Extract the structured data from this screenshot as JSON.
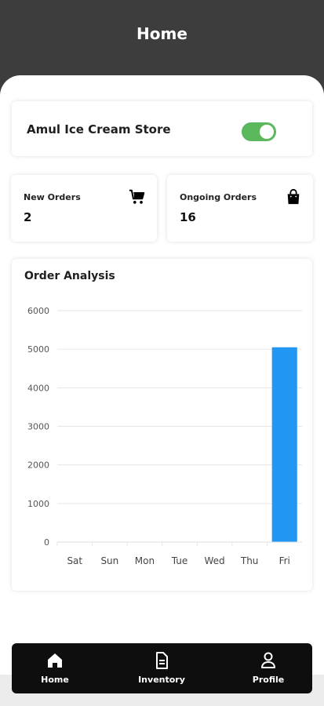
{
  "header": {
    "title": "Home"
  },
  "store": {
    "name": "Amul Ice Cream Store",
    "open_toggle_on": true,
    "toggle_color": "#5cb85c"
  },
  "stats": [
    {
      "label": "New Orders",
      "value": "2",
      "icon": "cart-icon"
    },
    {
      "label": "Ongoing Orders",
      "value": "16",
      "icon": "shopping-bag-icon"
    }
  ],
  "chart_title": "Order Analysis",
  "chart_data": {
    "type": "bar",
    "categories": [
      "Sat",
      "Sun",
      "Mon",
      "Tue",
      "Wed",
      "Thu",
      "Fri"
    ],
    "values": [
      0,
      0,
      0,
      0,
      0,
      0,
      5050
    ],
    "ylim": [
      0,
      6000
    ],
    "yticks": [
      0,
      1000,
      2000,
      3000,
      4000,
      5000,
      6000
    ],
    "bar_color": "#2196f3",
    "grid": true
  },
  "nav": [
    {
      "label": "Home",
      "icon": "home-icon"
    },
    {
      "label": "Inventory",
      "icon": "document-icon"
    },
    {
      "label": "Profile",
      "icon": "profile-icon"
    }
  ]
}
